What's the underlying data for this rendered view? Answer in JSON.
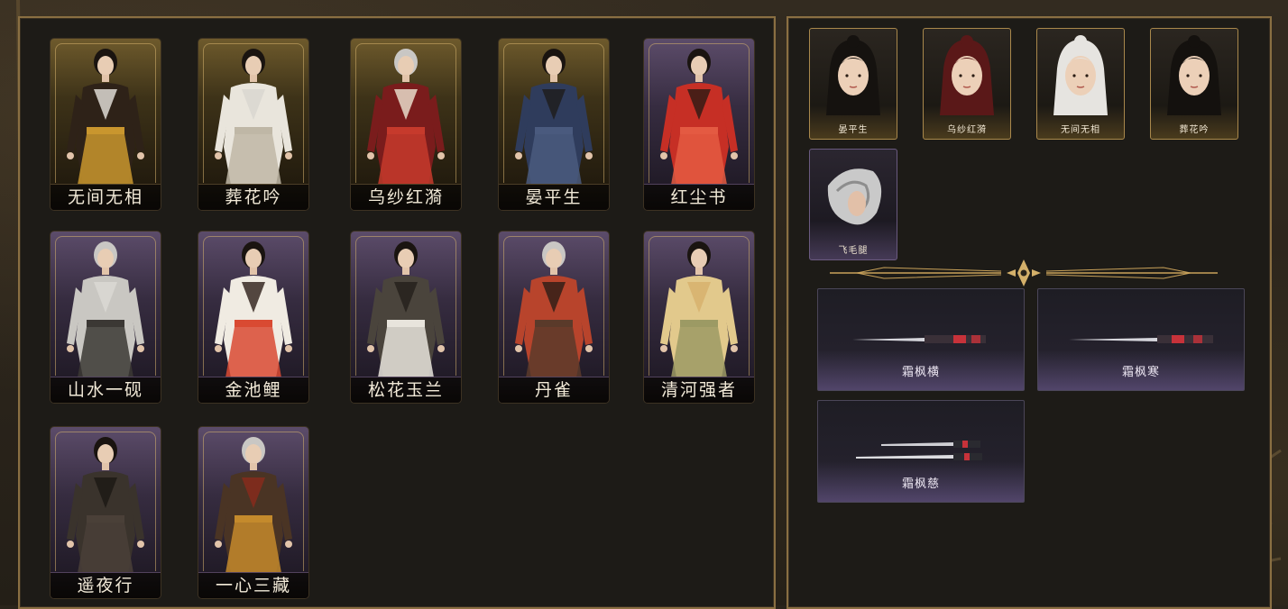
{
  "outfits": [
    {
      "label": "无间无相",
      "frame": "gold",
      "palette": [
        "#2e2218",
        "#c9962e",
        "#e8e6e0"
      ]
    },
    {
      "label": "葬花吟",
      "frame": "gold",
      "palette": [
        "#e9e5dc",
        "#bfb7a6",
        "#d8d6cf"
      ]
    },
    {
      "label": "乌纱红漪",
      "frame": "gold",
      "palette": [
        "#7a1c1c",
        "#c63a2c",
        "#efe7d4"
      ]
    },
    {
      "label": "晏平生",
      "frame": "gold",
      "palette": [
        "#2f3c5c",
        "#4a5a7e",
        "#1e1b1a"
      ]
    },
    {
      "label": "红尘书",
      "frame": "purple",
      "palette": [
        "#c62f25",
        "#e45a42",
        "#2a1a14"
      ]
    },
    {
      "label": "山水一砚",
      "frame": "purple",
      "palette": [
        "#c9c7c2",
        "#3b3834",
        "#dcdad4"
      ]
    },
    {
      "label": "金池鲤",
      "frame": "purple",
      "palette": [
        "#f0ebe2",
        "#d94a32",
        "#2c1d18"
      ]
    },
    {
      "label": "松花玉兰",
      "frame": "purple",
      "palette": [
        "#4a443c",
        "#e8e4dc",
        "#231f1a"
      ]
    },
    {
      "label": "丹雀",
      "frame": "purple",
      "palette": [
        "#b8442c",
        "#5a3a2a",
        "#2a1d16"
      ]
    },
    {
      "label": "清河强者",
      "frame": "purple",
      "palette": [
        "#e2c98c",
        "#9c9a64",
        "#d7b06c"
      ]
    },
    {
      "label": "遥夜行",
      "frame": "purple",
      "palette": [
        "#3a332c",
        "#4a4038",
        "#1c1814"
      ]
    },
    {
      "label": "一心三藏",
      "frame": "purple",
      "palette": [
        "#4a3424",
        "#c48a2c",
        "#8a2a1c"
      ]
    }
  ],
  "heads": [
    {
      "label": "晏平生",
      "frame": "gold",
      "hair": "#15120f"
    },
    {
      "label": "乌纱红漪",
      "frame": "gold",
      "hair": "#5a1818"
    },
    {
      "label": "无间无相",
      "frame": "gold",
      "hair": "#e6e4e0"
    },
    {
      "label": "葬花吟",
      "frame": "gold",
      "hair": "#14110e"
    },
    {
      "label": "飞毛腿",
      "frame": "purple",
      "hair": "#c9c9c9"
    }
  ],
  "weapons": [
    {
      "label": "霜枫横",
      "accent": "#c7323a"
    },
    {
      "label": "霜枫寒",
      "accent": "#c7323a"
    },
    {
      "label": "霜枫慈",
      "accent": "#c7323a"
    }
  ],
  "colors": {
    "gold_border": "#8a6f42",
    "text": "#f2ead8"
  }
}
